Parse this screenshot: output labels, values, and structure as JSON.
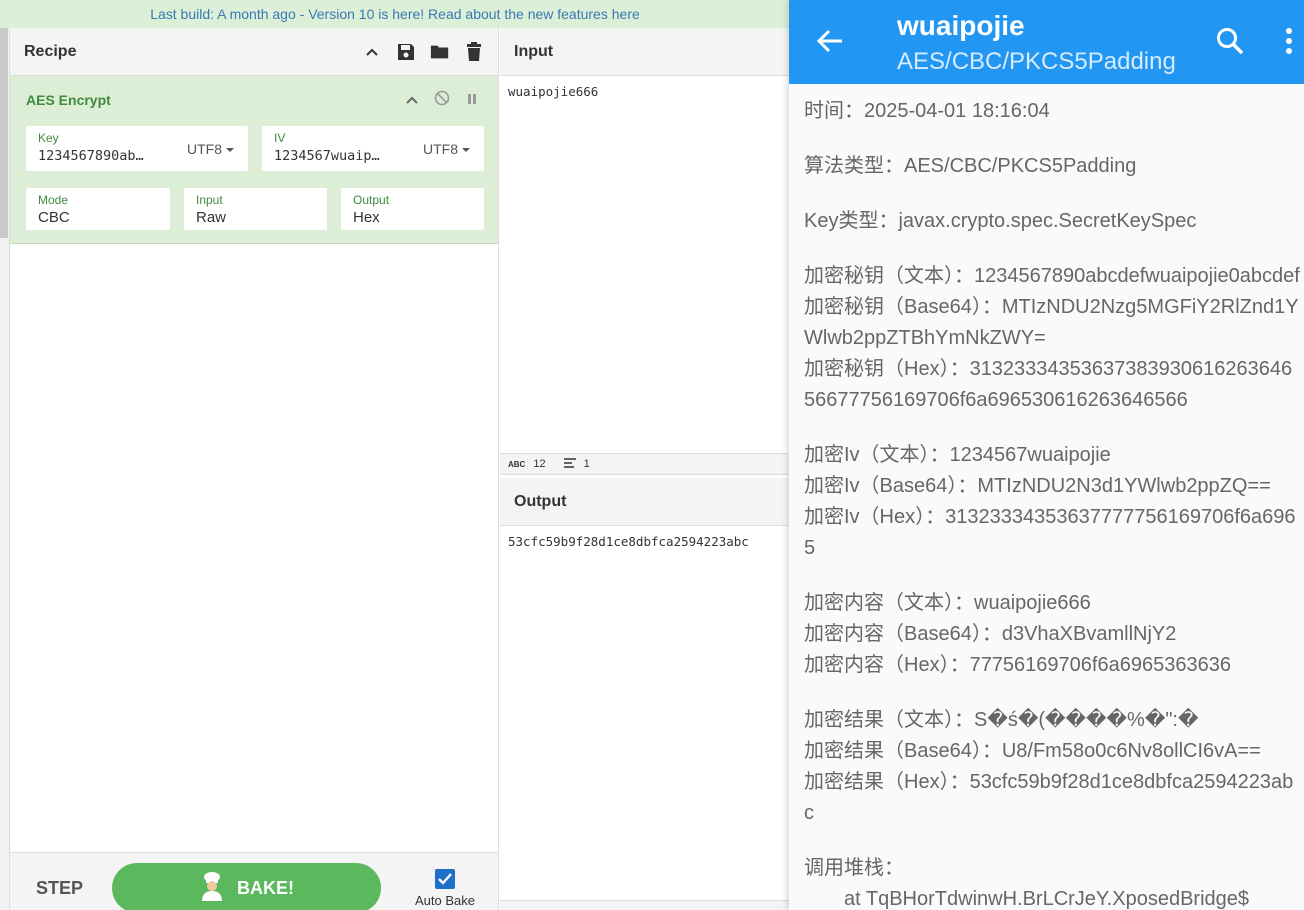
{
  "banner": {
    "link": "Last build: A month ago",
    "text": " - Version 10 is here! Read about the new features ",
    "link2": "here"
  },
  "recipe": {
    "title": "Recipe",
    "operation": {
      "name": "AES Encrypt",
      "key": {
        "label": "Key",
        "value": "1234567890ab…",
        "encoding": "UTF8"
      },
      "iv": {
        "label": "IV",
        "value": "1234567wuaip…",
        "encoding": "UTF8"
      },
      "mode": {
        "label": "Mode",
        "value": "CBC"
      },
      "input": {
        "label": "Input",
        "value": "Raw"
      },
      "output": {
        "label": "Output",
        "value": "Hex"
      }
    }
  },
  "controls": {
    "step": "STEP",
    "bake": "BAKE!",
    "auto_bake": "Auto Bake"
  },
  "input": {
    "title": "Input",
    "text": "wuaipojie666",
    "char_count": "12",
    "line_count": "1"
  },
  "output": {
    "title": "Output",
    "text": "53cfc59b9f28d1ce8dbfca2594223abc"
  },
  "app": {
    "title": "wuaipojie",
    "subtitle": "AES/CBC/PKCS5Padding",
    "log": {
      "time": "时间：2025-04-01 18:16:04",
      "algo": "算法类型：AES/CBC/PKCS5Padding",
      "keytype": "Key类型：javax.crypto.spec.SecretKeySpec",
      "key_text": "加密秘钥（文本）：1234567890abcdefwuaipojie0abcdef",
      "key_b64": "加密秘钥（Base64）：MTIzNDU2Nzg5MGFiY2RlZnd1YWlwb2ppZTBhYmNkZWY=",
      "key_hex": "加密秘钥（Hex）：3132333435363738393061626364656677756169706f6a696530616263646566",
      "iv_text": "加密Iv（文本）：1234567wuaipojie",
      "iv_b64": "加密Iv（Base64）：MTIzNDU2N3d1YWlwb2ppZQ==",
      "iv_hex": "加密Iv（Hex）：31323334353637777756169706f6a6965",
      "content_text": "加密内容（文本）：wuaipojie666",
      "content_b64": "加密内容（Base64）：d3VhaXBvamllNjY2",
      "content_hex": "加密内容（Hex）：77756169706f6a6965363636",
      "result_text": "加密结果（文本）：S�ś�(����%�\":�",
      "result_b64": "加密结果（Base64）：U8/Fm58o0c6Nv8ollCI6vA==",
      "result_hex": "加密结果（Hex）：53cfc59b9f28d1ce8dbfca2594223abc",
      "stack_label": "调用堆栈：",
      "stack_line": "at TqBHorTdwinwH.BrLCrJeY.XposedBridge$"
    }
  },
  "colors": {
    "appbar": "#2196f3",
    "bake": "#5cb85c",
    "operation_bg": "#dcefd6",
    "banner_bg": "#dcf0d8"
  }
}
